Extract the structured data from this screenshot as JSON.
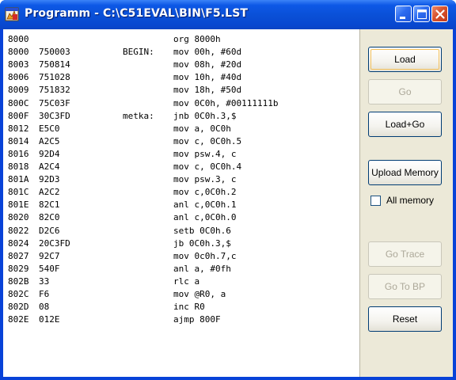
{
  "window": {
    "title": "Programm - C:\\C51EVAL\\BIN\\F5.LST",
    "app_icon": "program-app-icon",
    "controls": {
      "minimize": "minimize-icon",
      "maximize": "maximize-icon",
      "close": "close-icon"
    },
    "colors": {
      "titlebar": "#0a4fd6",
      "close": "#d8532e",
      "client": "#ece9d8"
    }
  },
  "listing": [
    {
      "addr": "8000",
      "code": "",
      "label": "",
      "instr": "org 8000h"
    },
    {
      "addr": "8000",
      "code": "750003",
      "label": "BEGIN:",
      "instr": "mov 00h, #60d"
    },
    {
      "addr": "8003",
      "code": "750814",
      "label": "",
      "instr": "mov 08h, #20d"
    },
    {
      "addr": "8006",
      "code": "751028",
      "label": "",
      "instr": "mov 10h, #40d"
    },
    {
      "addr": "8009",
      "code": "751832",
      "label": "",
      "instr": "mov 18h, #50d"
    },
    {
      "addr": "800C",
      "code": "75C03F",
      "label": "",
      "instr": "mov 0C0h, #00111111b"
    },
    {
      "addr": "800F",
      "code": "30C3FD",
      "label": "metka:",
      "instr": "jnb 0C0h.3,$"
    },
    {
      "addr": "8012",
      "code": "E5C0",
      "label": "",
      "instr": "mov a, 0C0h"
    },
    {
      "addr": "8014",
      "code": "A2C5",
      "label": "",
      "instr": "mov c, 0C0h.5"
    },
    {
      "addr": "8016",
      "code": "92D4",
      "label": "",
      "instr": "mov psw.4, c"
    },
    {
      "addr": "8018",
      "code": "A2C4",
      "label": "",
      "instr": "mov c, 0C0h.4"
    },
    {
      "addr": "801A",
      "code": "92D3",
      "label": "",
      "instr": "mov psw.3, c"
    },
    {
      "addr": "801C",
      "code": "A2C2",
      "label": "",
      "instr": "mov c,0C0h.2"
    },
    {
      "addr": "801E",
      "code": "82C1",
      "label": "",
      "instr": "anl c,0C0h.1"
    },
    {
      "addr": "8020",
      "code": "82C0",
      "label": "",
      "instr": "anl c,0C0h.0"
    },
    {
      "addr": "8022",
      "code": "D2C6",
      "label": "",
      "instr": "setb 0C0h.6"
    },
    {
      "addr": "8024",
      "code": "20C3FD",
      "label": "",
      "instr": "jb 0C0h.3,$"
    },
    {
      "addr": "8027",
      "code": "92C7",
      "label": "",
      "instr": "mov 0c0h.7,c"
    },
    {
      "addr": "8029",
      "code": "540F",
      "label": "",
      "instr": "anl a, #0fh"
    },
    {
      "addr": "802B",
      "code": "33",
      "label": "",
      "instr": "rlc a"
    },
    {
      "addr": "802C",
      "code": "F6",
      "label": "",
      "instr": "mov @R0, a"
    },
    {
      "addr": "802D",
      "code": "08",
      "label": "",
      "instr": "inc R0"
    },
    {
      "addr": "802E",
      "code": "012E",
      "label": "",
      "instr": "ajmp 800F"
    }
  ],
  "buttons": {
    "load": {
      "label": "Load",
      "enabled": true,
      "focused": true
    },
    "go": {
      "label": "Go",
      "enabled": false
    },
    "load_go": {
      "label": "Load+Go",
      "enabled": true
    },
    "upload_memory": {
      "label": "Upload Memory",
      "enabled": true
    },
    "go_trace": {
      "label": "Go Trace",
      "enabled": false
    },
    "go_to_bp": {
      "label": "Go To BP",
      "enabled": false
    },
    "reset": {
      "label": "Reset",
      "enabled": true
    }
  },
  "all_memory": {
    "label": "All memory",
    "checked": false
  }
}
